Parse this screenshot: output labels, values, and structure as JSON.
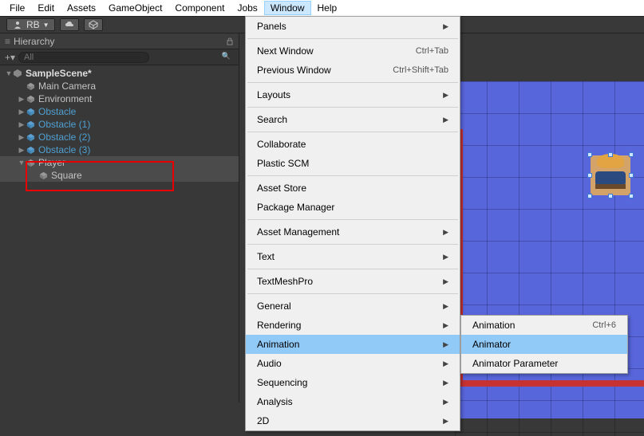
{
  "menubar": {
    "items": [
      "File",
      "Edit",
      "Assets",
      "GameObject",
      "Component",
      "Jobs",
      "Window",
      "Help"
    ],
    "active_index": 6
  },
  "toolbar": {
    "account": "RB"
  },
  "hierarchy": {
    "title": "Hierarchy",
    "search_placeholder": "All",
    "nodes": {
      "scene": "SampleScene*",
      "main_camera": "Main Camera",
      "environment": "Environment",
      "obstacle": "Obstacle",
      "obstacle1": "Obstacle (1)",
      "obstacle2": "Obstacle (2)",
      "obstacle3": "Obstacle (3)",
      "player": "Player",
      "square": "Square"
    }
  },
  "window_menu": {
    "panels": "Panels",
    "next_window": "Next Window",
    "next_window_sc": "Ctrl+Tab",
    "prev_window": "Previous Window",
    "prev_window_sc": "Ctrl+Shift+Tab",
    "layouts": "Layouts",
    "search": "Search",
    "collaborate": "Collaborate",
    "plastic": "Plastic SCM",
    "asset_store": "Asset Store",
    "package_manager": "Package Manager",
    "asset_management": "Asset Management",
    "text": "Text",
    "textmeshpro": "TextMeshPro",
    "general": "General",
    "rendering": "Rendering",
    "animation": "Animation",
    "audio": "Audio",
    "sequencing": "Sequencing",
    "analysis": "Analysis",
    "two_d": "2D"
  },
  "animation_submenu": {
    "animation": "Animation",
    "animation_sc": "Ctrl+6",
    "animator": "Animator",
    "animator_param": "Animator Parameter"
  }
}
